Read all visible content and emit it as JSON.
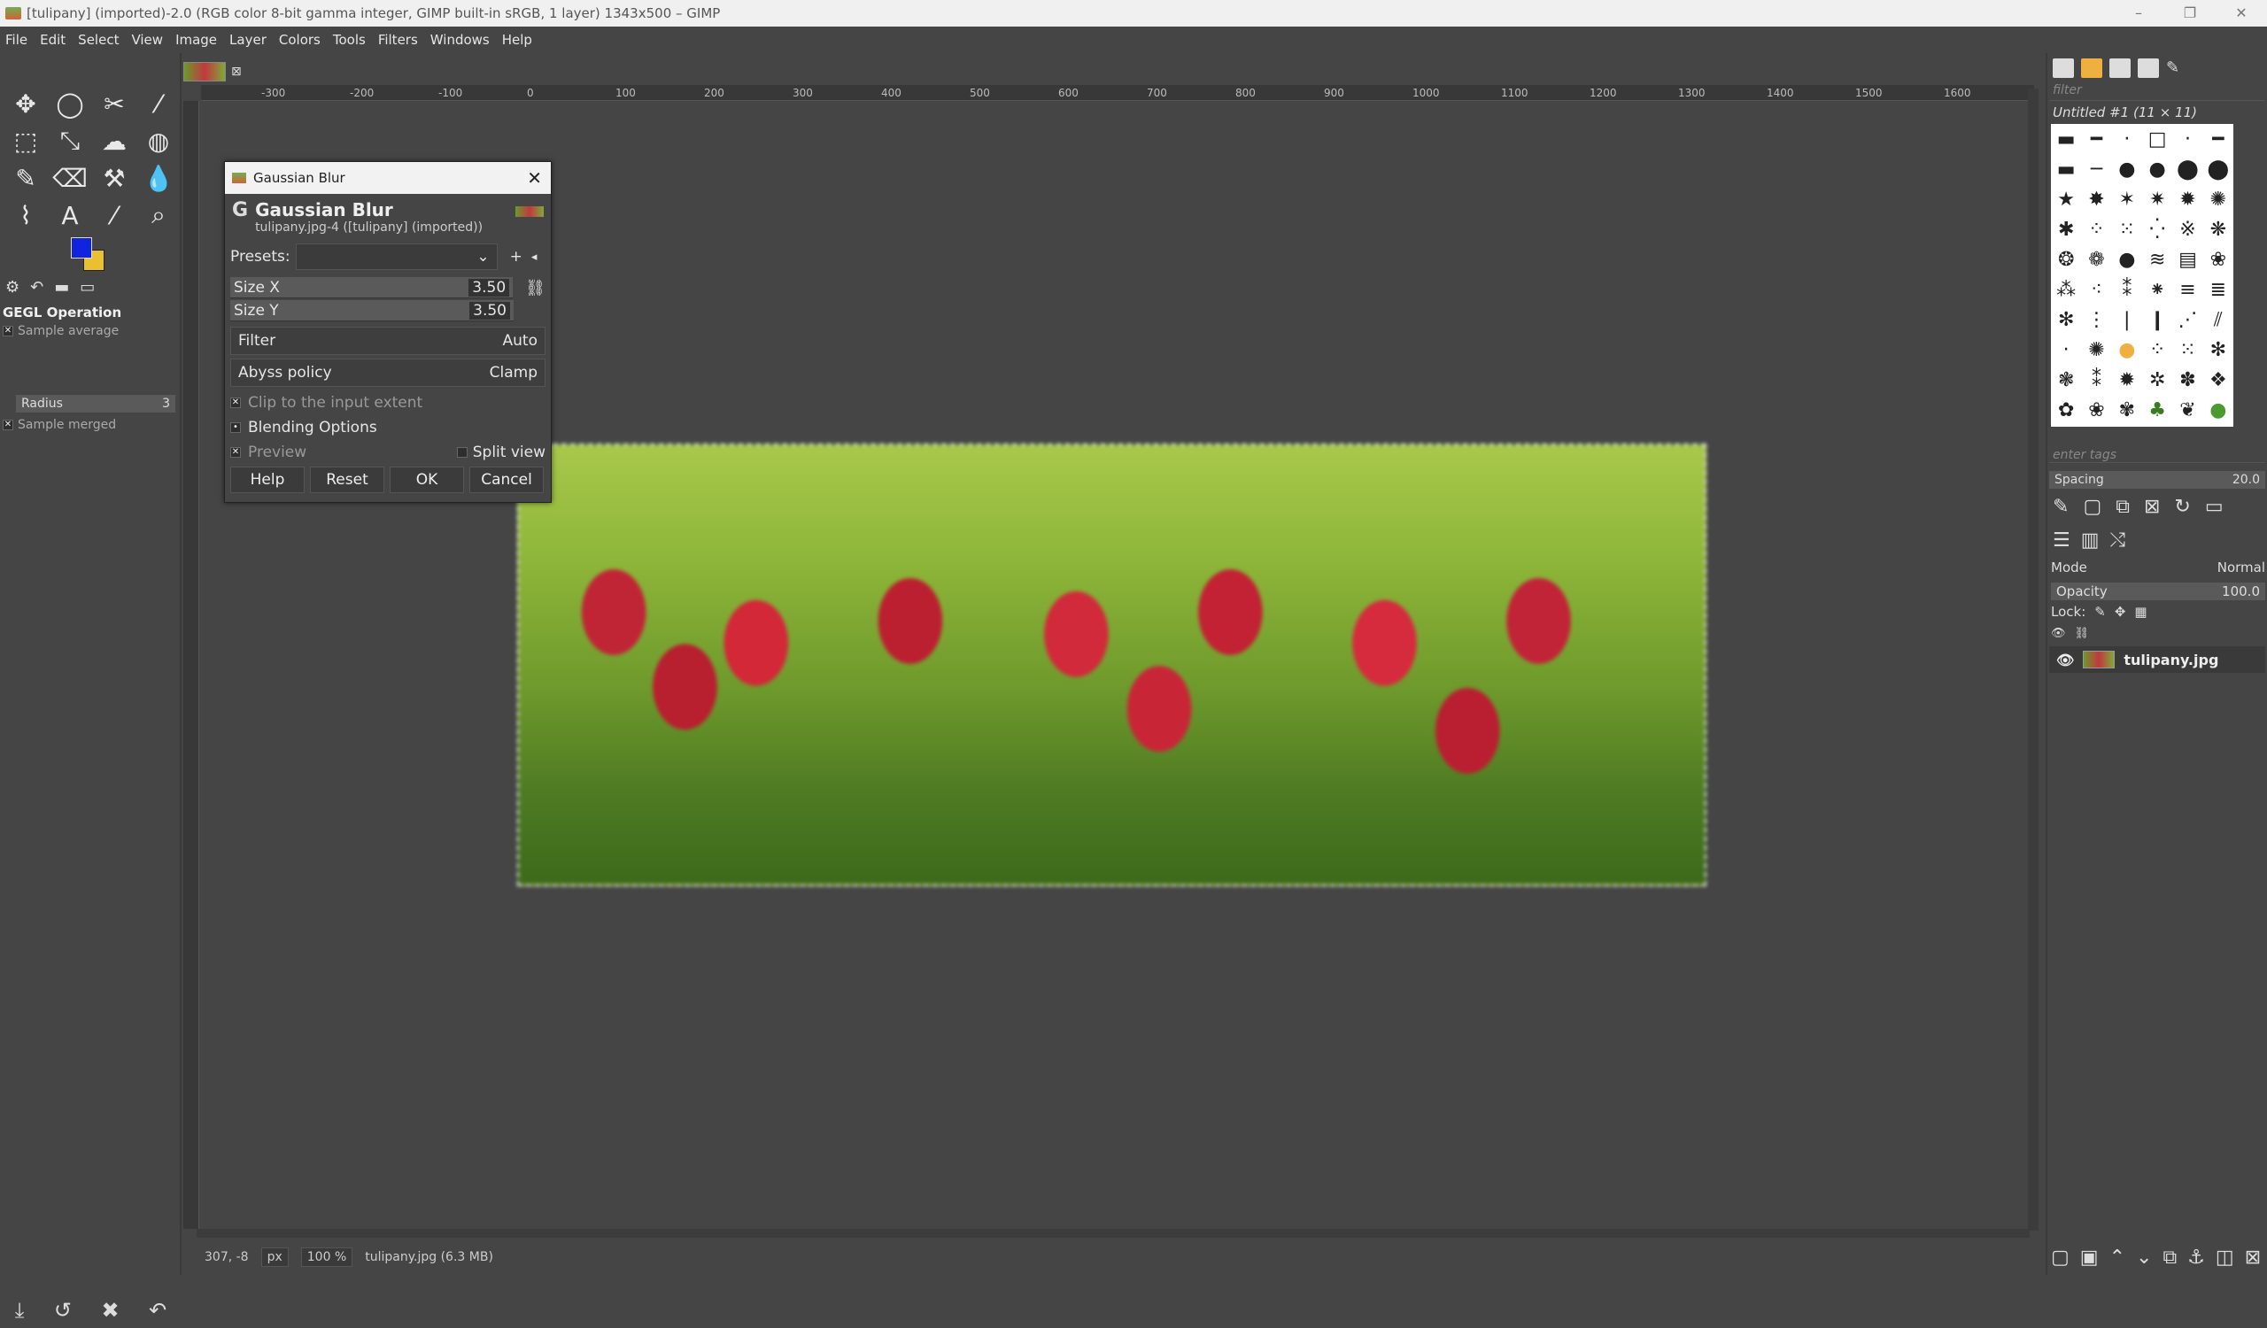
{
  "window": {
    "title": "[tulipany] (imported)-2.0 (RGB color 8-bit gamma integer, GIMP built-in sRGB, 1 layer) 1343x500 – GIMP",
    "controls": [
      "–",
      "❐",
      "✕"
    ]
  },
  "menu": [
    "File",
    "Edit",
    "Select",
    "View",
    "Image",
    "Layer",
    "Colors",
    "Tools",
    "Filters",
    "Windows",
    "Help"
  ],
  "toolbox": {
    "tools": [
      "✥",
      "◯",
      "✂",
      "⁄",
      "⬚",
      "⤡",
      "☁",
      "◍",
      "✎",
      "⌫",
      "⚒",
      "💧",
      "⌇",
      "A",
      "⁄",
      "⌕"
    ],
    "tool_options_title": "GEGL Operation",
    "sample_average_label": "Sample average",
    "radius_label": "Radius",
    "radius_value": "3",
    "sample_merged_label": "Sample merged",
    "bottom_icons": [
      "⤓",
      "↺",
      "✖",
      "↶"
    ]
  },
  "canvas": {
    "ruler_ticks": [
      "-300",
      "-200",
      "-100",
      "0",
      "100",
      "200",
      "300",
      "400",
      "500",
      "600",
      "700",
      "800",
      "900",
      "1000",
      "1100",
      "1200",
      "1300",
      "1400",
      "1500",
      "1600"
    ],
    "image_size": "1343x500"
  },
  "status": {
    "coords": "307, -8",
    "unit": "px",
    "zoom": "100 %",
    "file": "tulipany.jpg (6.3 MB)"
  },
  "dialog": {
    "title": "Gaussian Blur",
    "header_name": "Gaussian Blur",
    "header_sub": "tulipany.jpg-4 ([tulipany] (imported))",
    "presets_label": "Presets:",
    "size_x_label": "Size X",
    "size_x_value": "3.50",
    "size_y_label": "Size Y",
    "size_y_value": "3.50",
    "filter_label": "Filter",
    "filter_value": "Auto",
    "abyss_label": "Abyss policy",
    "abyss_value": "Clamp",
    "clip_label": "Clip to the input extent",
    "blending_label": "Blending Options",
    "preview_label": "Preview",
    "split_label": "Split view",
    "buttons": [
      "Help",
      "Reset",
      "OK",
      "Cancel"
    ]
  },
  "right_dock": {
    "filter_placeholder": "filter",
    "brush_name": "Untitled #1 (11 × 11)",
    "tags_placeholder": "enter tags",
    "spacing_label": "Spacing",
    "spacing_value": "20.0",
    "mode_label": "Mode",
    "mode_value": "Normal",
    "opacity_label": "Opacity",
    "opacity_value": "100.0",
    "lock_label": "Lock:",
    "layer_name": "tulipany.jpg"
  }
}
